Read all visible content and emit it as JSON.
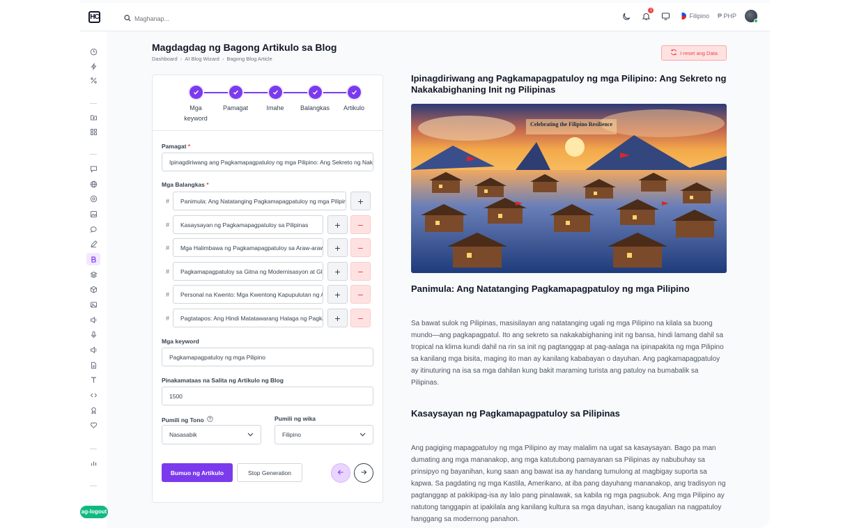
{
  "header": {
    "logo_text": "HC",
    "search_placeholder": "Maghanap...",
    "language": "Filipino",
    "currency": "₱ PHP",
    "notification_count": "1"
  },
  "sidebar": {
    "logout_label": "ag-logout",
    "items": [
      "clock-icon",
      "bolt-icon",
      "percent-icon",
      "folder-plus-icon",
      "grid-icon",
      "message-icon",
      "globe-icon",
      "aperture-icon",
      "image-icon",
      "chat-icon",
      "pen-icon",
      "blog-icon",
      "layers-icon",
      "cube-icon",
      "photo-icon",
      "speaker-icon",
      "mic-icon",
      "sound-icon",
      "file-icon",
      "text-icon",
      "code-icon",
      "award-icon",
      "heart-icon",
      "bar-chart-icon"
    ]
  },
  "page": {
    "title": "Magdagdag ng Bagong Artikulo sa Blog",
    "breadcrumb": [
      "Dashboard",
      "AI Blog Wizard",
      "Bagong Blog Article"
    ],
    "reset_label": "I-reset ang Data"
  },
  "steps": [
    {
      "label": "Mga keyword"
    },
    {
      "label": "Pamagat"
    },
    {
      "label": "Imahe"
    },
    {
      "label": "Balangkas"
    },
    {
      "label": "Artikulo"
    }
  ],
  "form": {
    "title_label": "Pamagat",
    "title_value": "Ipinagdiriwang ang Pagkamapagpatuloy ng mga Pilipino: Ang Sekreto ng Nakakabighaning Init ng Pilipinas",
    "outline_label": "Mga Balangkas",
    "outlines": [
      "Panimula: Ang Natatanging Pagkamapagpatuloy ng mga Pilipino",
      "Kasaysayan ng Pagkamapagpatuloy sa Pilipinas",
      "Mga Halimbawa ng Pagkamapagpatuloy sa Araw-araw na Buhay",
      "Pagkamapagpatuloy sa Gitna ng Modernisasyon at Globalisasyon",
      "Personal na Kwento: Mga Kwentong Kapupulutan ng Aral",
      "Pagtatapos: Ang Hindi Matatawarang Halaga ng Pagkamapagpatuloy"
    ],
    "keyword_label": "Mga keyword",
    "keyword_value": "Pagkamapagpatuloy ng mga Pilipino",
    "max_words_label": "Pinakamataas na Salita ng Artikulo ng Blog",
    "max_words_value": "1500",
    "tone_label": "Pumili ng Tono",
    "tone_value": "Nasasabik",
    "language_label": "Pumili ng wika",
    "language_value": "Filipino",
    "generate_label": "Bumuo ng Artikulo",
    "stop_label": "Stop Generation"
  },
  "article": {
    "title": "Ipinagdiriwang ang Pagkamapagpatuloy ng mga Pilipino: Ang Sekreto ng Nakakabighaning Init ng Pilipinas",
    "image_caption": "Celebrating the Filipino Resilience",
    "section1_heading": "Panimula: Ang Natatanging Pagkamapagpatuloy ng mga Pilipino",
    "section1_body": "Sa bawat sulok ng Pilipinas, masisilayan ang natatanging ugali ng mga Pilipino na kilala sa buong mundo—ang pagkapagpatul. Ito ang sekreto sa nakakabighaning init ng bansa, hindi lamang dahil sa tropical na klima kundi dahil na rin sa init ng pagtanggap at pag-aalaga na ipinapakita ng mga Pilipino sa kanilang mga bisita, maging ito man ay kanilang kababayan o dayuhan. Ang pagkamapagpatuloy ay itinuturing na isa sa mga dahilan kung bakit maraming turista ang patuloy na bumabalik sa Pilipinas.",
    "section2_heading": "Kasaysayan ng Pagkamapagpatuloy sa Pilipinas",
    "section2_body": "Ang pagiging mapagpatuloy ng mga Pilipino ay may malalim na ugat sa kasaysayan. Bago pa man dumating ang mga mananakop, ang mga katutubong pamayanan sa Pilipinas ay nabubuhay sa prinsipyo ng bayanihan, kung saan ang bawat isa ay handang tumulong at magbigay suporta sa kapwa. Sa pagdating ng mga Kastila, Amerikano, at iba pang dayuhang mananakop, ang tradisyon ng pagtanggap at pakikipag-isa ay lalo pang pinalawak, sa kabila ng mga pagsubok. Ang mga Pilipino ay natutong tanggapin at ipakilala ang kanilang kultura sa mga dayuhan, isang kaugalian na nagpatuloy hanggang sa modernong panahon."
  },
  "colors": {
    "accent": "#7c3aed",
    "danger": "#ef4444",
    "success": "#10b981"
  }
}
